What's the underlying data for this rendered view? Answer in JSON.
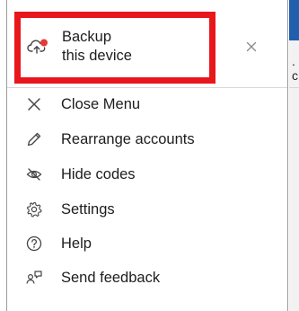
{
  "background_app": {
    "fragment_line_1": ".",
    "fragment_line_2": "c"
  },
  "menu": {
    "backup": {
      "line1": "Backup",
      "line2": "this device",
      "icon": "cloud-upload-icon",
      "badge_color": "#e53935"
    },
    "close_x_icon": "close-icon",
    "items": [
      {
        "label": "Close Menu",
        "icon": "close-icon"
      },
      {
        "label": "Rearrange accounts",
        "icon": "pencil-icon"
      },
      {
        "label": "Hide codes",
        "icon": "eye-off-icon"
      },
      {
        "label": "Settings",
        "icon": "gear-icon"
      },
      {
        "label": "Help",
        "icon": "help-circle-icon"
      },
      {
        "label": "Send feedback",
        "icon": "feedback-person-icon"
      }
    ]
  },
  "colors": {
    "highlight": "#e8171b",
    "app_bar": "#1f5fae",
    "text": "#1d1d1d",
    "icon": "#444444"
  }
}
